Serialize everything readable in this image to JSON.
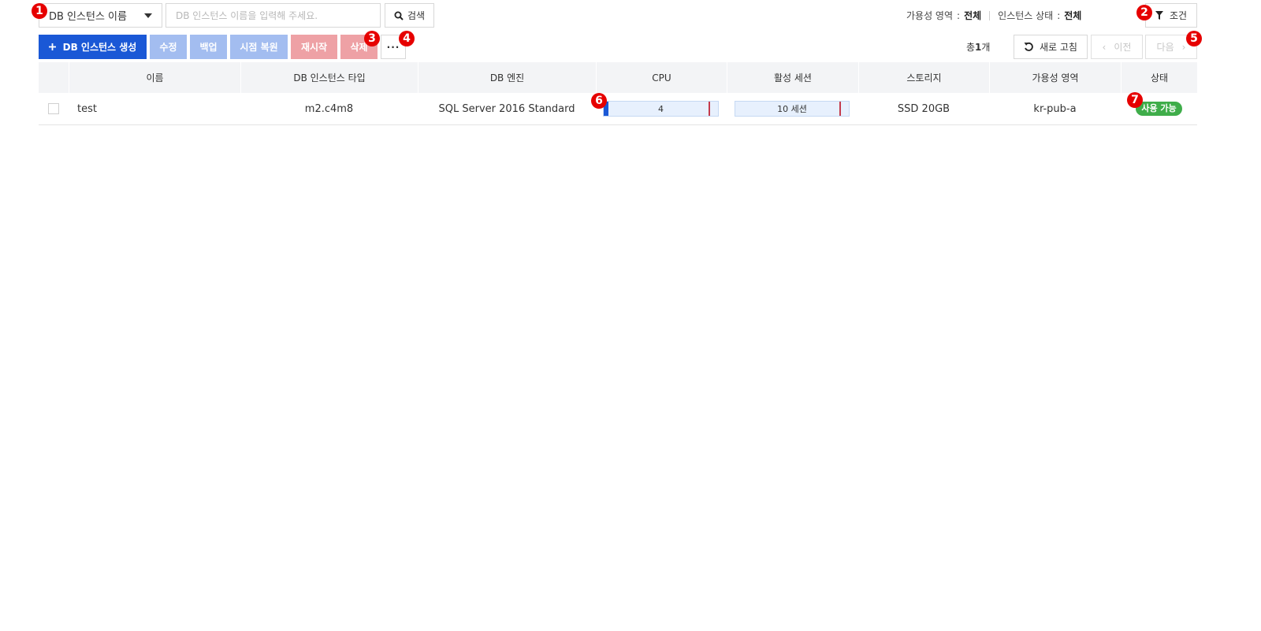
{
  "toolbar": {
    "search_type": "DB 인스턴스 이름",
    "search_placeholder": "DB 인스턴스 이름을 입력해 주세요.",
    "search_label": "검색",
    "zone_label": "가용성 영역",
    "zone_value": "전체",
    "status_label": "인스턴스 상태",
    "status_value": "전체",
    "colon": ":",
    "condition_label": "조건"
  },
  "actions": {
    "create": "DB 인스턴스 생성",
    "edit": "수정",
    "backup": "백업",
    "restore": "시점 복원",
    "restart": "재시작",
    "delete": "삭제",
    "more": "···"
  },
  "pager": {
    "total_prefix": "총",
    "total_count": "1",
    "total_suffix": "개",
    "refresh": "새로 고침",
    "prev": "이전",
    "next": "다음"
  },
  "table": {
    "columns": [
      "이름",
      "DB 인스턴스 타입",
      "DB 엔진",
      "CPU",
      "활성 세션",
      "스토리지",
      "가용성 영역",
      "상태"
    ],
    "rows": [
      {
        "name": "test",
        "type": "m2.c4m8",
        "engine": "SQL Server 2016 Standard",
        "cpu": "4",
        "cpu_usage_fraction": 0.04,
        "cpu_threshold_fraction": 0.92,
        "sessions": "10 세션",
        "sessions_threshold_fraction": 0.92,
        "storage": "SSD 20GB",
        "zone": "kr-pub-a",
        "status": "사용 가능"
      }
    ]
  },
  "markers": [
    "1",
    "2",
    "3",
    "4",
    "5",
    "6",
    "7"
  ],
  "colors": {
    "primary": "#1a58d6",
    "primary_disabled": "#a3bdf0",
    "danger_disabled": "#eea1a5",
    "status_ok": "#3fad4a",
    "marker": "#e60000"
  },
  "icons": {
    "search": "search-icon",
    "filter": "filter-icon",
    "plus": "plus-icon",
    "refresh": "refresh-icon",
    "prev": "chevron-left-icon",
    "next": "chevron-right-icon",
    "dropdown": "caret-down-icon"
  }
}
